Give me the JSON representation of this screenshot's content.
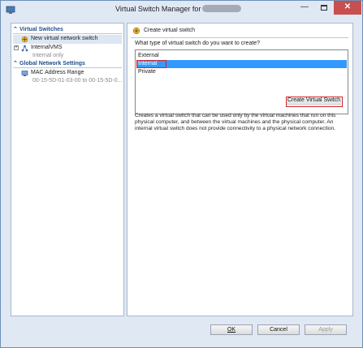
{
  "window": {
    "title": "Virtual Switch Manager for"
  },
  "titlebar": {
    "minimize": "—",
    "close": "✕"
  },
  "sidebar": {
    "virtual_switches": {
      "heading": "Virtual Switches",
      "items": [
        {
          "label": "New virtual network switch"
        },
        {
          "label": "InternalVMS",
          "sub": "Internal only"
        }
      ]
    },
    "global_network": {
      "heading": "Global Network Settings",
      "items": [
        {
          "label": "MAC Address Range",
          "sub": "00-15-5D-01-03-00 to 00-15-5D-0..."
        }
      ]
    }
  },
  "panel": {
    "heading": "Create virtual switch",
    "question": "What type of virtual switch do you want to create?",
    "options": [
      "External",
      "Internal",
      "Private"
    ],
    "selected_option": "Internal",
    "create_button": "Create Virtual Switch",
    "description": "Creates a virtual switch that can be used only by the virtual machines that run on this physical computer, and between the virtual machines and the physical computer. An internal virtual switch does not provide connectivity to a physical network connection."
  },
  "footer": {
    "ok": "OK",
    "cancel": "Cancel",
    "apply": "Apply"
  },
  "colors": {
    "highlight": "#d2242b",
    "selection": "#3399ff",
    "heading": "#1f4e8c"
  },
  "icons": [
    "hyperv-app-icon",
    "switch-icon",
    "network-icon",
    "mac-range-icon",
    "create-switch-icon"
  ]
}
